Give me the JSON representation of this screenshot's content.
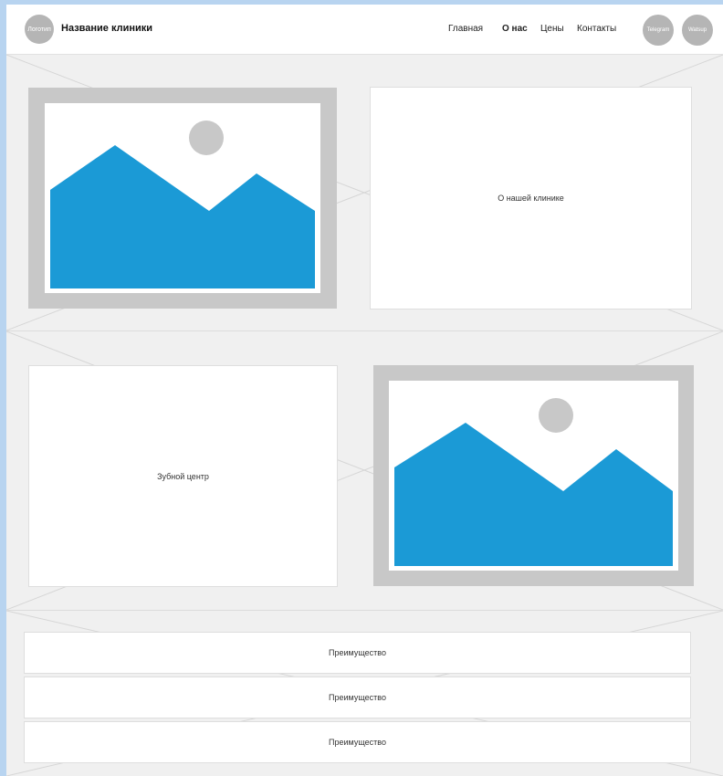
{
  "header": {
    "logo_label": "Логотип",
    "clinic_name": "Название клиники",
    "nav": [
      {
        "label": "Главная",
        "active": false
      },
      {
        "label": "О нас",
        "active": true
      },
      {
        "label": "Цены",
        "active": false
      },
      {
        "label": "Контакты",
        "active": false
      }
    ],
    "social": {
      "telegram": "Telegram",
      "whatsapp": "Watsup"
    }
  },
  "about": {
    "title": "О нашей клинике",
    "image_icon": "image-placeholder-icon"
  },
  "center": {
    "title": "Зубной центр",
    "image_icon": "image-placeholder-icon"
  },
  "advantages": [
    {
      "label": "Преимущество"
    },
    {
      "label": "Преимущество"
    },
    {
      "label": "Преимущество"
    }
  ],
  "colors": {
    "page_bg": "#f0f0f0",
    "image_frame": "#c8c8c8",
    "mountain": "#1b9ad6",
    "sun": "#c8c8c8"
  }
}
